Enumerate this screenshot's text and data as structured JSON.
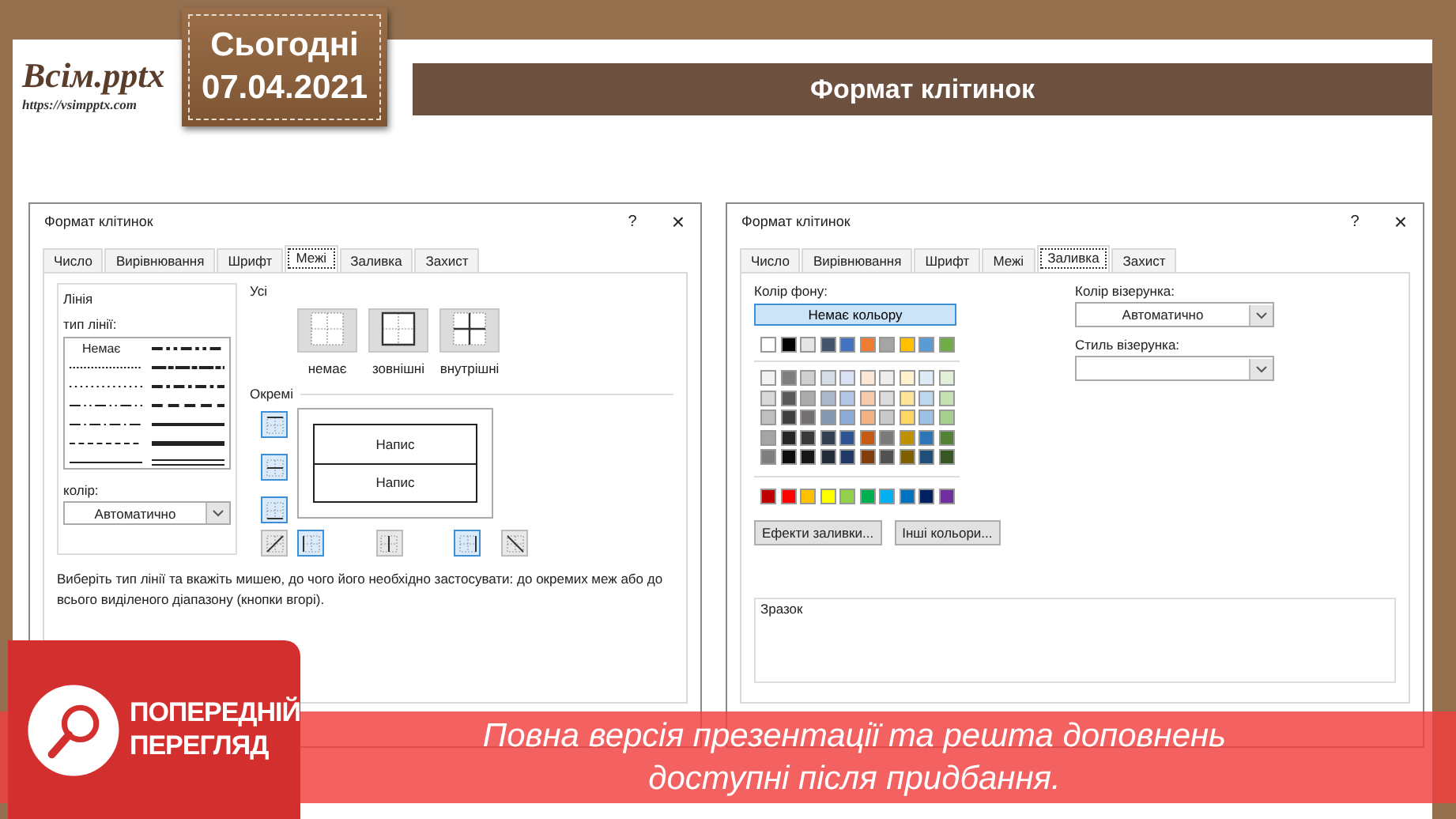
{
  "logo": {
    "name": "Всім.pptx",
    "url": "https://vsimpptx.com"
  },
  "date_badge": {
    "label": "Сьогодні",
    "date": "07.04.2021"
  },
  "slide_title": "Формат клітинок",
  "dialogs": [
    {
      "kind": "borders",
      "title": "Формат клітинок",
      "help": "?",
      "close": "×",
      "tabs": [
        {
          "label": "Число",
          "selected": false
        },
        {
          "label": "Вирівнювання",
          "selected": false
        },
        {
          "label": "Шрифт",
          "selected": false
        },
        {
          "label": "Межі",
          "selected": true
        },
        {
          "label": "Заливка",
          "selected": false
        },
        {
          "label": "Захист",
          "selected": false
        }
      ],
      "line_group": "Лінія",
      "line_type_label": "тип лінії:",
      "line_styles": [
        {
          "kind": "none",
          "label": "Немає"
        },
        {
          "kind": "hair"
        },
        {
          "kind": "dotted"
        },
        {
          "kind": "dashdotdot"
        },
        {
          "kind": "dashdot"
        },
        {
          "kind": "dashed"
        },
        {
          "kind": "thin"
        },
        {
          "kind": "mdashdotdot"
        },
        {
          "kind": "slant"
        },
        {
          "kind": "mdashdot"
        },
        {
          "kind": "mdashed"
        },
        {
          "kind": "medium"
        },
        {
          "kind": "thick"
        },
        {
          "kind": "double"
        }
      ],
      "color_label": "колір:",
      "color_value": "Автоматично",
      "presets_label": "Усі",
      "presets": [
        {
          "kind": "none",
          "label": "немає"
        },
        {
          "kind": "outline",
          "label": "зовнішні"
        },
        {
          "kind": "inside",
          "label": "внутрішні"
        }
      ],
      "separate_label": "Окремі",
      "side_toggles": [
        {
          "kind": "top",
          "on": true
        },
        {
          "kind": "horizontal",
          "on": true
        },
        {
          "kind": "bottom",
          "on": true
        }
      ],
      "bottom_toggles": [
        {
          "kind": "diag-up",
          "on": false
        },
        {
          "kind": "left",
          "on": true
        },
        {
          "kind": "vertical",
          "on": false
        },
        {
          "kind": "right",
          "on": true
        },
        {
          "kind": "diag-down",
          "on": false
        }
      ],
      "preview_texts": [
        "Напис",
        "Напис"
      ],
      "hint": "Виберіть тип лінії та вкажіть мишею, до чого його необхідно застосувати: до окремих меж або до всього виділеного діапазону (кнопки вгорі)."
    },
    {
      "kind": "fill",
      "title": "Формат клітинок",
      "help": "?",
      "close": "×",
      "tabs": [
        {
          "label": "Число",
          "selected": false
        },
        {
          "label": "Вирівнювання",
          "selected": false
        },
        {
          "label": "Шрифт",
          "selected": false
        },
        {
          "label": "Межі",
          "selected": false
        },
        {
          "label": "Заливка",
          "selected": true
        },
        {
          "label": "Захист",
          "selected": false
        }
      ],
      "bg_label": "Колір фону:",
      "no_color": "Немає кольору",
      "theme_colors": [
        {
          "color": "#ffffff"
        },
        {
          "color": "#000000"
        },
        {
          "color": "#e7e6e6"
        },
        {
          "color": "#44546a"
        },
        {
          "color": "#4472c4"
        },
        {
          "color": "#ed7d31"
        },
        {
          "color": "#a5a5a5"
        },
        {
          "color": "#ffc000"
        },
        {
          "color": "#5b9bd5"
        },
        {
          "color": "#70ad47"
        }
      ],
      "tint_rows": [
        {
          "swatches": [
            {
              "color": "#f2f2f2"
            },
            {
              "color": "#7f7f7f"
            },
            {
              "color": "#d0cece"
            },
            {
              "color": "#d6dce4"
            },
            {
              "color": "#d9e2f3"
            },
            {
              "color": "#fbe5d5"
            },
            {
              "color": "#ededed"
            },
            {
              "color": "#fff2cc"
            },
            {
              "color": "#deebf6"
            },
            {
              "color": "#e2efd9"
            }
          ]
        },
        {
          "swatches": [
            {
              "color": "#d8d8d8"
            },
            {
              "color": "#595959"
            },
            {
              "color": "#aeabab"
            },
            {
              "color": "#adb9ca"
            },
            {
              "color": "#b4c6e7"
            },
            {
              "color": "#f7cbac"
            },
            {
              "color": "#dbdbdb"
            },
            {
              "color": "#fee599"
            },
            {
              "color": "#bdd7ee"
            },
            {
              "color": "#c5e0b3"
            }
          ]
        },
        {
          "swatches": [
            {
              "color": "#bfbfbf"
            },
            {
              "color": "#3f3f3f"
            },
            {
              "color": "#757070"
            },
            {
              "color": "#8496b0"
            },
            {
              "color": "#8eaadb"
            },
            {
              "color": "#f4b183"
            },
            {
              "color": "#c9c9c9"
            },
            {
              "color": "#ffd965"
            },
            {
              "color": "#9cc3e5"
            },
            {
              "color": "#a8d08d"
            }
          ]
        },
        {
          "swatches": [
            {
              "color": "#a5a5a5"
            },
            {
              "color": "#262626"
            },
            {
              "color": "#3a3838"
            },
            {
              "color": "#323f4f"
            },
            {
              "color": "#2f5496"
            },
            {
              "color": "#c55a11"
            },
            {
              "color": "#7b7b7b"
            },
            {
              "color": "#bf9000"
            },
            {
              "color": "#2e75b5"
            },
            {
              "color": "#538135"
            }
          ]
        },
        {
          "swatches": [
            {
              "color": "#7f7f7f"
            },
            {
              "color": "#0c0c0c"
            },
            {
              "color": "#171616"
            },
            {
              "color": "#222a35"
            },
            {
              "color": "#1f3864"
            },
            {
              "color": "#833c0b"
            },
            {
              "color": "#525252"
            },
            {
              "color": "#7f6000"
            },
            {
              "color": "#1e4e79"
            },
            {
              "color": "#375623"
            }
          ]
        }
      ],
      "standard_colors": [
        {
          "color": "#c00000"
        },
        {
          "color": "#ff0000"
        },
        {
          "color": "#ffc000"
        },
        {
          "color": "#ffff00"
        },
        {
          "color": "#92d050"
        },
        {
          "color": "#00b050"
        },
        {
          "color": "#00b0f0"
        },
        {
          "color": "#0070c0"
        },
        {
          "color": "#002060"
        },
        {
          "color": "#7030a0"
        }
      ],
      "effects_button": "Ефекти заливки...",
      "more_colors_button": "Інші кольори...",
      "pattern_color_label": "Колір візерунка:",
      "pattern_color_value": "Автоматично",
      "pattern_style_label": "Стиль візерунка:",
      "sample_label": "Зразок"
    }
  ],
  "preview_banner": {
    "badge_lines": [
      "ПОПЕРЕДНІЙ",
      "ПЕРЕГЛЯД"
    ],
    "notice_lines": [
      "Повна версія презентації та решта доповнень",
      "доступні після придбання."
    ]
  }
}
